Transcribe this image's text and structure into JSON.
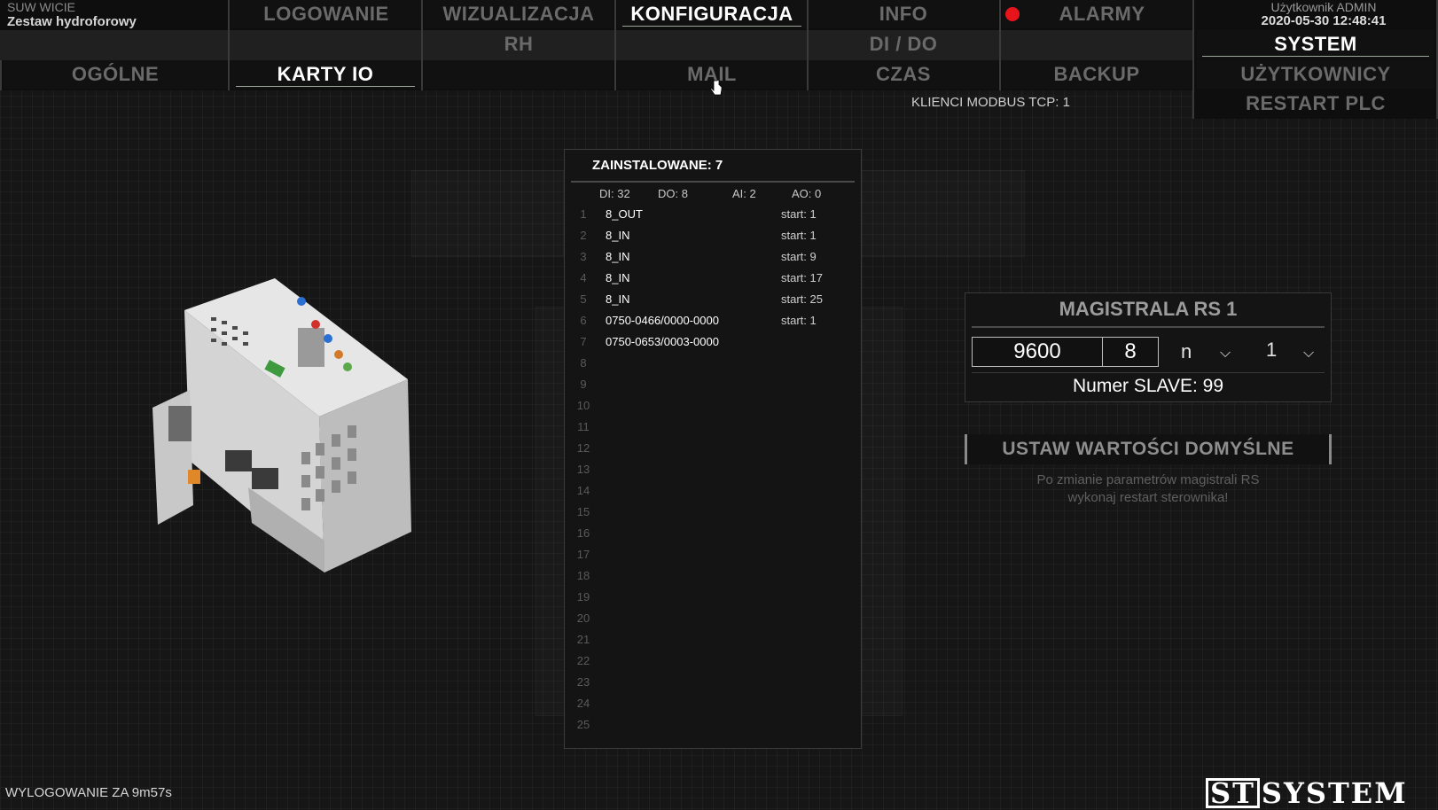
{
  "header": {
    "brand_line1": "SUW WICIE",
    "brand_line2": "Zestaw hydroforowy",
    "user_line1": "Użytkownik ADMIN",
    "user_line2": "2020-05-30 12:48:41"
  },
  "nav": {
    "logowanie": "LOGOWANIE",
    "wizualizacja": "WIZUALIZACJA",
    "konfiguracja": "KONFIGURACJA",
    "info": "INFO",
    "alarmy": "ALARMY",
    "rh": "RH",
    "system": "SYSTEM",
    "di_do": "DI / DO",
    "ogolne": "OGÓLNE",
    "karty_io": "KARTY IO",
    "mail": "MAIL",
    "czas": "CZAS",
    "backup": "BACKUP",
    "uzytkownicy": "UŻYTKOWNICY",
    "restart_plc": "RESTART PLC",
    "alarm_color": "#e8141c"
  },
  "status": {
    "modbus_clients": "KLIENCI MODBUS TCP: 1",
    "logout_timer": "WYLOGOWANIE ZA 9m57s"
  },
  "io": {
    "title": "ZAINSTALOWANE: 7",
    "di": "DI: 32",
    "do": "DO: 8",
    "ai": "AI: 2",
    "ao": "AO: 0",
    "rows": [
      {
        "num": "1",
        "name": "8_OUT",
        "start": "start: 1"
      },
      {
        "num": "2",
        "name": "8_IN",
        "start": "start: 1"
      },
      {
        "num": "3",
        "name": "8_IN",
        "start": "start: 9"
      },
      {
        "num": "4",
        "name": "8_IN",
        "start": "start: 17"
      },
      {
        "num": "5",
        "name": "8_IN",
        "start": "start: 25"
      },
      {
        "num": "6",
        "name": "0750-0466/0000-0000",
        "start": "start: 1"
      },
      {
        "num": "7",
        "name": "0750-0653/0003-0000",
        "start": ""
      },
      {
        "num": "8",
        "name": "",
        "start": ""
      },
      {
        "num": "9",
        "name": "",
        "start": ""
      },
      {
        "num": "10",
        "name": "",
        "start": ""
      },
      {
        "num": "11",
        "name": "",
        "start": ""
      },
      {
        "num": "12",
        "name": "",
        "start": ""
      },
      {
        "num": "13",
        "name": "",
        "start": ""
      },
      {
        "num": "14",
        "name": "",
        "start": ""
      },
      {
        "num": "15",
        "name": "",
        "start": ""
      },
      {
        "num": "16",
        "name": "",
        "start": ""
      },
      {
        "num": "17",
        "name": "",
        "start": ""
      },
      {
        "num": "18",
        "name": "",
        "start": ""
      },
      {
        "num": "19",
        "name": "",
        "start": ""
      },
      {
        "num": "20",
        "name": "",
        "start": ""
      },
      {
        "num": "21",
        "name": "",
        "start": ""
      },
      {
        "num": "22",
        "name": "",
        "start": ""
      },
      {
        "num": "23",
        "name": "",
        "start": ""
      },
      {
        "num": "24",
        "name": "",
        "start": ""
      },
      {
        "num": "25",
        "name": "",
        "start": ""
      }
    ]
  },
  "rs": {
    "title": "MAGISTRALA RS 1",
    "baud": "9600",
    "data_bits": "8",
    "parity": "n",
    "stop_bits": "1",
    "slave": "Numer SLAVE: 99",
    "default_button": "USTAW WARTOŚCI DOMYŚLNE",
    "note_line1": "Po zmianie parametrów magistrali RS",
    "note_line2": "wykonaj restart sterownika!"
  },
  "logo": {
    "prefix": "ST",
    "suffix": "SYSTEM"
  }
}
